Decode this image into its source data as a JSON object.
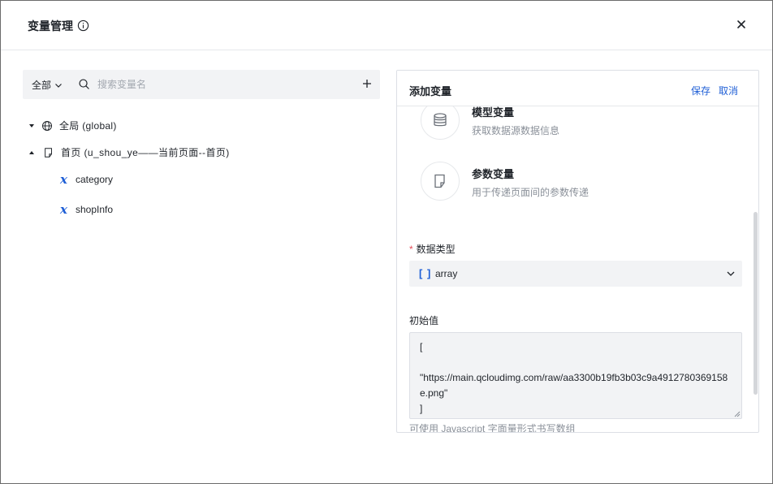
{
  "dialog": {
    "title": "变量管理",
    "close_icon": "close-icon",
    "info_icon": "info-icon"
  },
  "toolbar": {
    "scope_selected": "全部",
    "search_placeholder": "搜索变量名",
    "add_icon": "plus-icon"
  },
  "tree": {
    "global_label": "全局 (global)",
    "page_label": "首页 (u_shou_ye——当前页面--首页)",
    "variables": [
      {
        "name": "category"
      },
      {
        "name": "shopInfo"
      }
    ]
  },
  "panel": {
    "title": "添加变量",
    "save_label": "保存",
    "cancel_label": "取消",
    "variable_types": [
      {
        "name": "模型变量",
        "desc": "获取数据源数据信息",
        "icon": "database-icon"
      },
      {
        "name": "参数变量",
        "desc": "用于传递页面间的参数传递",
        "icon": "document-icon"
      }
    ],
    "data_type_label": "数据类型",
    "data_type_icon_text": "[ ]",
    "data_type_value": "array",
    "initial_value_label": "初始值",
    "initial_value": "[\n\n\"https://main.qcloudimg.com/raw/aa3300b19fb3b03c9a4912780369158e.png\"\n]",
    "hint": "可使用 Javascript 字面量形式书写数组"
  },
  "colors": {
    "accent": "#1f5fd6",
    "required": "#e34d59",
    "input_bg": "#f2f3f5"
  }
}
